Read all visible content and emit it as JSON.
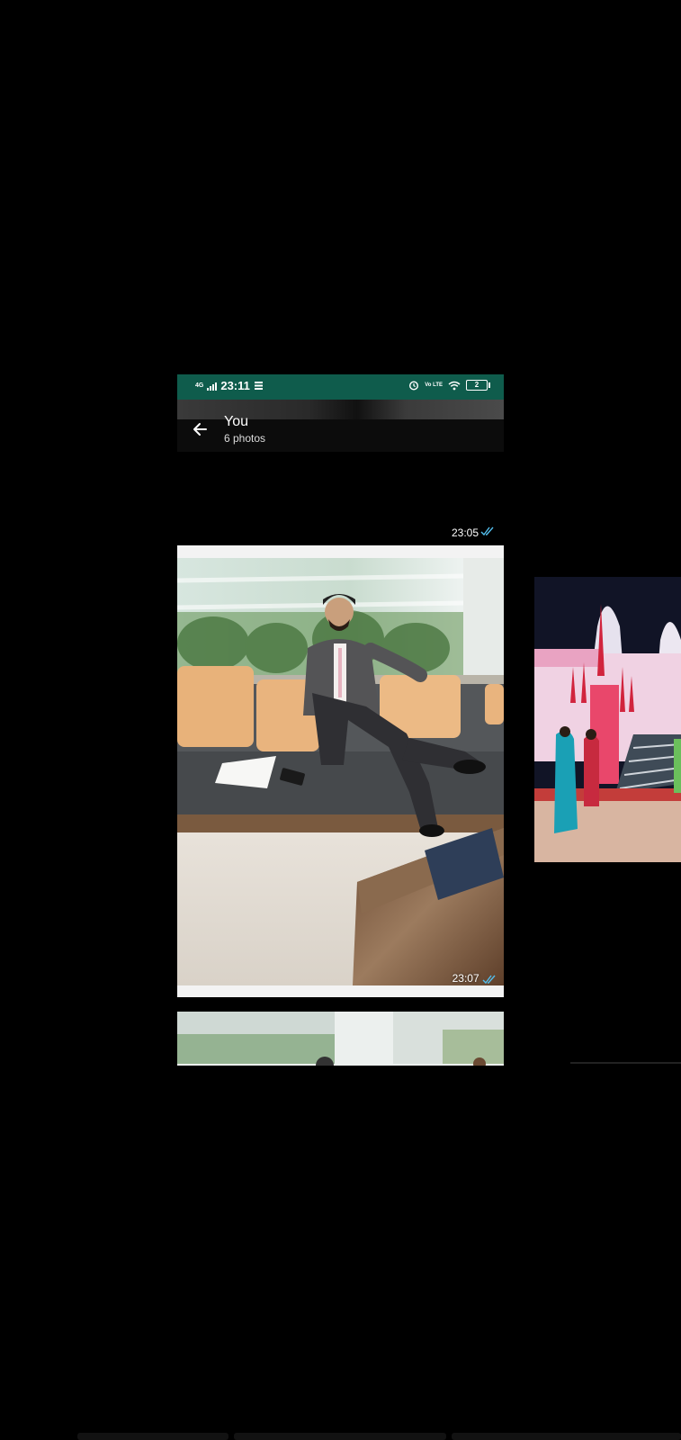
{
  "status_bar": {
    "network": "4G",
    "time": "23:11",
    "volte": "Vo LTE",
    "battery": "2"
  },
  "header": {
    "title": "You",
    "subtitle": "6 photos"
  },
  "messages": [
    {
      "time": "23:05",
      "status": "read"
    },
    {
      "time": "23:07",
      "status": "read"
    }
  ],
  "icons": {
    "back": "arrow-left-icon",
    "read_receipt": "double-check-icon",
    "alarm": "alarm-icon",
    "wifi": "wifi-icon",
    "battery": "battery-icon",
    "signal": "signal-icon"
  },
  "colors": {
    "status_bar_bg": "#0f5c4c",
    "read_tick": "#53bdeb"
  }
}
